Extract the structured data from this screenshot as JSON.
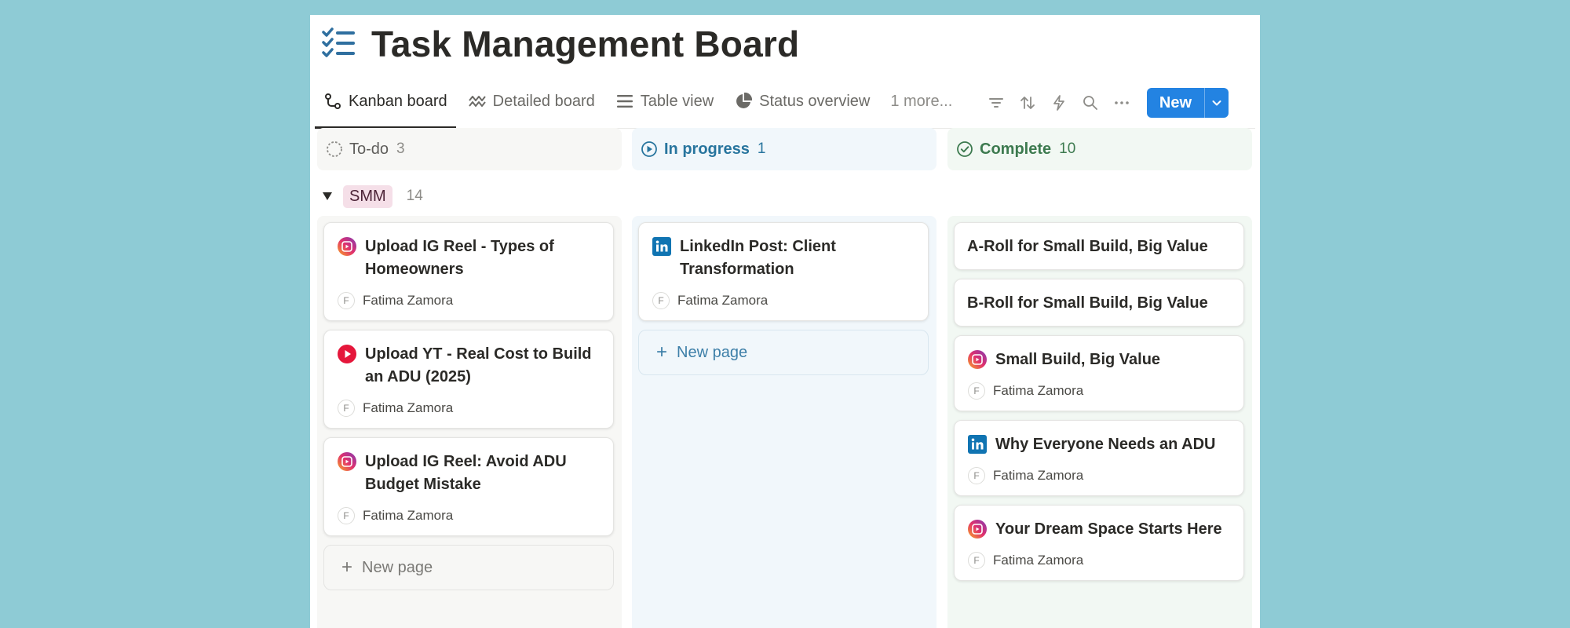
{
  "board": {
    "title": "Task Management Board",
    "title_icon": "checklist-icon"
  },
  "tabs": [
    {
      "label": "Kanban board",
      "icon": "kanban-icon",
      "active": true
    },
    {
      "label": "Detailed board",
      "icon": "wave-icon",
      "active": false
    },
    {
      "label": "Table view",
      "icon": "list-icon",
      "active": false
    },
    {
      "label": "Status overview",
      "icon": "pie-chart-icon",
      "active": false
    }
  ],
  "more_tabs": "1 more...",
  "toolbar": {
    "new_label": "New",
    "accent": "#2383e2"
  },
  "columns": {
    "todo": {
      "name": "To-do",
      "count": "3"
    },
    "in_progress": {
      "name": "In progress",
      "count": "1"
    },
    "complete": {
      "name": "Complete",
      "count": "10"
    }
  },
  "group": {
    "tag": "SMM",
    "count": "14"
  },
  "cards": {
    "todo": [
      {
        "title": "Upload IG Reel - Types of Homeowners",
        "icon": "instagram-icon",
        "assignee": "Fatima Zamora",
        "initial": "F"
      },
      {
        "title": "Upload YT - Real Cost to Build an ADU (2025)",
        "icon": "youtube-icon",
        "assignee": "Fatima Zamora",
        "initial": "F"
      },
      {
        "title": "Upload IG Reel: Avoid ADU Budget Mistake",
        "icon": "instagram-icon",
        "assignee": "Fatima Zamora",
        "initial": "F"
      }
    ],
    "in_progress": [
      {
        "title": "LinkedIn Post: Client Transformation",
        "icon": "linkedin-icon",
        "assignee": "Fatima Zamora",
        "initial": "F"
      }
    ],
    "complete": [
      {
        "title": "A-Roll for Small Build, Big Value"
      },
      {
        "title": "B-Roll for Small Build, Big Value"
      },
      {
        "title": "Small Build, Big Value",
        "icon": "instagram-icon",
        "assignee": "Fatima Zamora",
        "initial": "F"
      },
      {
        "title": "Why Everyone Needs an ADU",
        "icon": "linkedin-icon",
        "assignee": "Fatima Zamora",
        "initial": "F"
      },
      {
        "title": "Your Dream Space Starts Here",
        "icon": "instagram-icon",
        "assignee": "Fatima Zamora",
        "initial": "F"
      }
    ]
  },
  "new_page_label": "New page"
}
